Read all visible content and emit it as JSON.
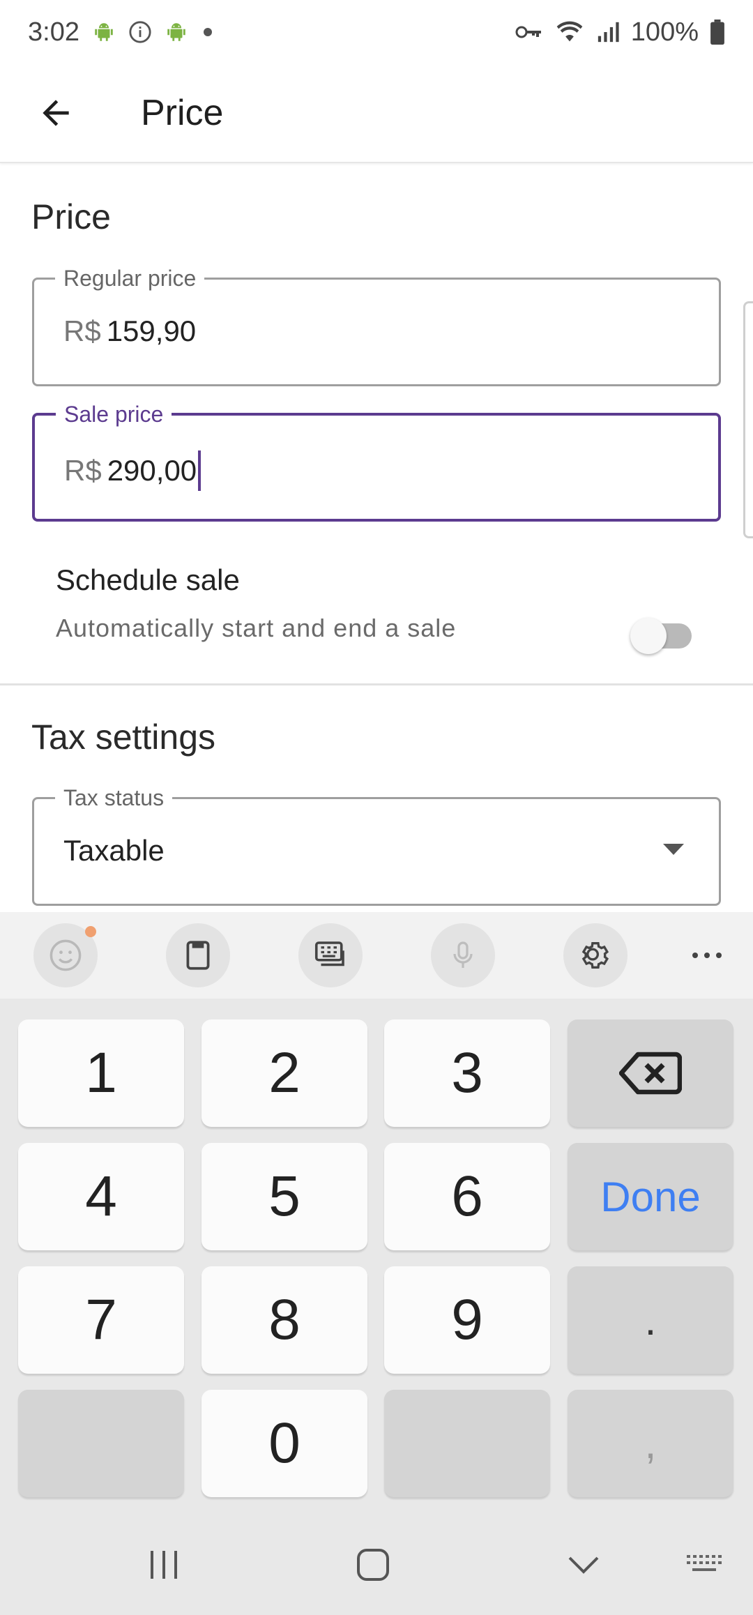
{
  "status_bar": {
    "time": "3:02",
    "battery": "100%"
  },
  "app_bar": {
    "title": "Price"
  },
  "price_section": {
    "title": "Price",
    "regular_price": {
      "label": "Regular price",
      "prefix": "R$",
      "value": "159,90"
    },
    "sale_price": {
      "label": "Sale price",
      "prefix": "R$",
      "value": "290,00"
    },
    "schedule": {
      "title": "Schedule sale",
      "subtitle": "Automatically start and end a sale",
      "enabled": false
    }
  },
  "tax_section": {
    "title": "Tax settings",
    "tax_status": {
      "label": "Tax status",
      "value": "Taxable"
    }
  },
  "keyboard": {
    "toolbar_icons": [
      "emoji-icon",
      "clipboard-icon",
      "keyboard-mode-icon",
      "microphone-icon",
      "settings-icon",
      "more-icon"
    ],
    "keys": {
      "k1": "1",
      "k2": "2",
      "k3": "3",
      "k4": "4",
      "k5": "5",
      "k6": "6",
      "k7": "7",
      "k8": "8",
      "k9": "9",
      "k0": "0",
      "done": "Done",
      "period": ".",
      "comma": ","
    }
  },
  "colors": {
    "accent": "#5c3b8f",
    "done_blue": "#3f7ff2"
  }
}
